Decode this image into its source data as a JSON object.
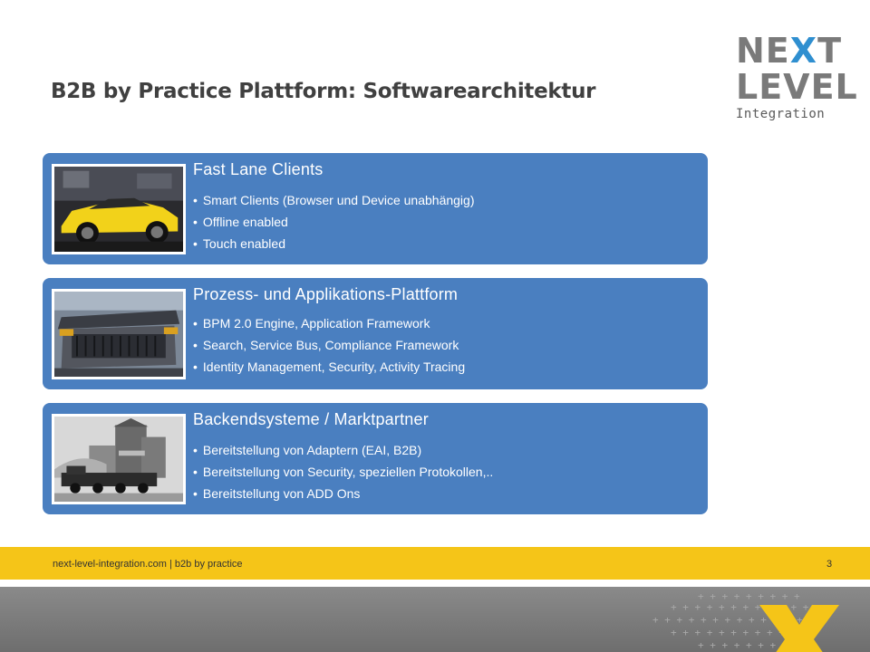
{
  "slide": {
    "title": "B2B by Practice Plattform: Softwarearchitektur"
  },
  "logo": {
    "line1_a": "NE",
    "line1_x": "X",
    "line1_b": "T",
    "line2": "LEVEL",
    "line3": "Integration",
    "accent_color": "#2f8fd0"
  },
  "cards": [
    {
      "title": "Fast Lane Clients",
      "image_icon": "sports-car-image",
      "items": [
        "Smart Clients (Browser und Device unabhängig)",
        "Offline enabled",
        "Touch enabled"
      ]
    },
    {
      "title": "Prozess- und Applikations-Plattform",
      "image_icon": "car-rear-engine-image",
      "items": [
        "BPM 2.0 Engine, Application Framework",
        "Search,  Service Bus, Compliance Framework",
        "Identity Management, Security, Activity Tracing"
      ]
    },
    {
      "title": "Backendsysteme / Marktpartner",
      "image_icon": "steam-train-grain-elevator-image",
      "items": [
        "Bereitstellung von Adaptern  (EAI, B2B)",
        "Bereitstellung von Security, speziellen Protokollen,..",
        "Bereitstellung von ADD Ons"
      ]
    }
  ],
  "footer": {
    "text": "next-level-integration.com | b2b by practice",
    "page_number": "3",
    "band_color": "#f5c518"
  },
  "colors": {
    "card_bg": "#4a7fc0",
    "title": "#404040"
  }
}
